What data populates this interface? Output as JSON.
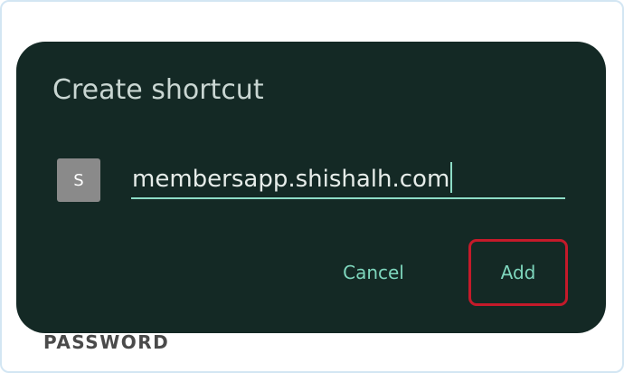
{
  "background": {
    "label": "PASSWORD"
  },
  "dialog": {
    "title": "Create shortcut",
    "favicon_letter": "S",
    "name_value": "membersapp.shishalh.com",
    "cancel_label": "Cancel",
    "add_label": "Add"
  },
  "colors": {
    "dialog_background": "#142925",
    "accent": "#7ed6bd",
    "highlight_border": "#c41a2a"
  },
  "icons": {
    "favicon": "site-favicon-icon"
  }
}
